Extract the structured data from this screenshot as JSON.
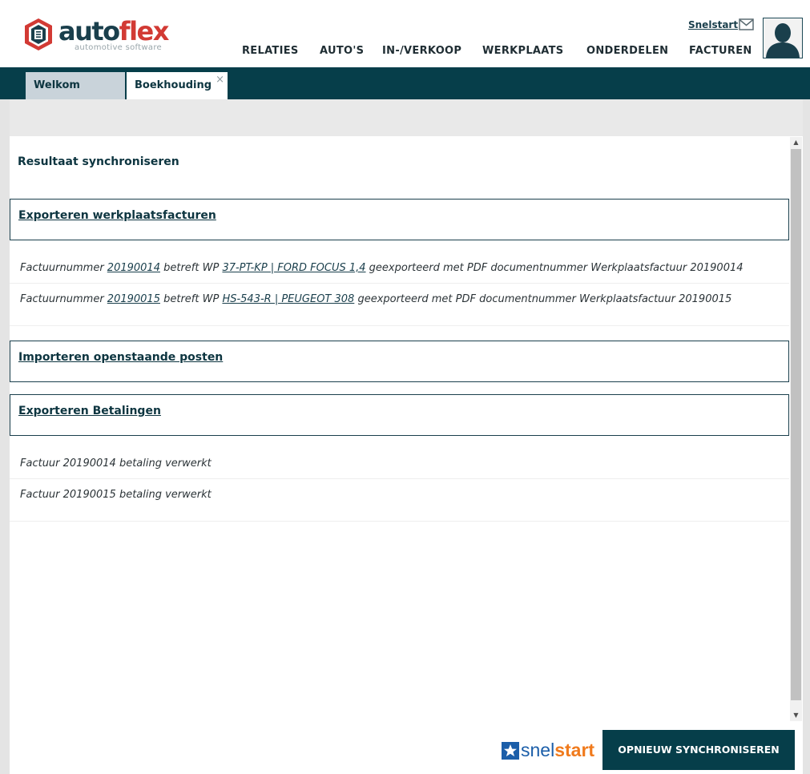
{
  "brand": {
    "name_part1": "auto",
    "name_part2": "flex",
    "tagline": "automotive software"
  },
  "header": {
    "snelstart_link": "Snelstart",
    "mail_icon": "mail-icon",
    "avatar_icon": "user-avatar-icon"
  },
  "nav": {
    "items": [
      {
        "label": "RELATIES"
      },
      {
        "label": "AUTO'S"
      },
      {
        "label": "IN-/VERKOOP"
      },
      {
        "label": "WERKPLAATS"
      },
      {
        "label": "ONDERDELEN"
      },
      {
        "label": "FACTUREN"
      }
    ]
  },
  "tabs": [
    {
      "label": "Welkom",
      "active": false
    },
    {
      "label": "Boekhouding",
      "active": true,
      "close": "×"
    }
  ],
  "main": {
    "title": "Resultaat synchroniseren",
    "sections": [
      {
        "title": "Exporteren werkplaatsfacturen",
        "lines": [
          {
            "prefix": "Factuurnummer ",
            "invoice": "20190014",
            "mid": " betreft WP ",
            "vehicle": "37-PT-KP | FORD FOCUS 1,4",
            "suffix": " geexporteerd met PDF documentnummer Werkplaatsfactuur 20190014"
          },
          {
            "prefix": "Factuurnummer ",
            "invoice": "20190015",
            "mid": " betreft WP ",
            "vehicle": "HS-543-R | PEUGEOT 308",
            "suffix": " geexporteerd met PDF documentnummer Werkplaatsfactuur 20190015"
          }
        ]
      },
      {
        "title": "Importeren openstaande posten",
        "lines": []
      },
      {
        "title": "Exporteren Betalingen",
        "lines": [
          {
            "text": "Factuur 20190014 betaling verwerkt"
          },
          {
            "text": "Factuur 20190015 betaling verwerkt"
          }
        ]
      }
    ]
  },
  "footer": {
    "partner_logo_snel": "snel",
    "partner_logo_start": "start",
    "resync_button": "OPNIEUW SYNCHRONISEREN"
  },
  "colors": {
    "brand_dark": "#063e4a",
    "brand_red": "#d23a34",
    "snelstart_blue": "#1b5ea9",
    "snelstart_orange": "#f07a1c"
  }
}
